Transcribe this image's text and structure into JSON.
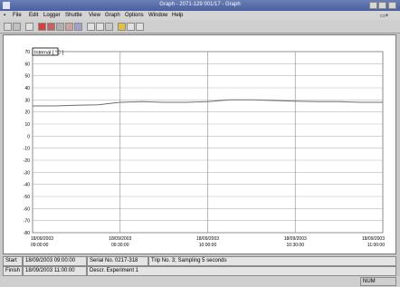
{
  "window": {
    "title": "Graph - 2071-129 001/17 - Graph"
  },
  "menu": [
    "File",
    "Edit",
    "Logger",
    "Shuttle",
    "View",
    "Graph",
    "Options",
    "Window",
    "Help"
  ],
  "chart": {
    "channel_label": "Internal [ °C ]"
  },
  "chart_data": {
    "type": "line",
    "ylim": [
      -80,
      70
    ],
    "y_ticks": [
      "70",
      "60",
      "50",
      "40",
      "30",
      "20",
      "10",
      "0",
      "-10",
      "-20",
      "-30",
      "-40",
      "-50",
      "-60",
      "-70",
      "-80"
    ],
    "x_ticks": [
      {
        "date": "18/09/2003",
        "time": "09:00:00"
      },
      {
        "date": "18/09/2003",
        "time": "09:30:00"
      },
      {
        "date": "18/09/2003",
        "time": "10:00:00"
      },
      {
        "date": "18/09/2003",
        "time": "10:30:00"
      },
      {
        "date": "18/09/2003",
        "time": "11:00:00"
      }
    ],
    "series": [
      {
        "color": "#6e6e6e",
        "x": [
          "09:00:00",
          "09:07:30",
          "09:15:00",
          "09:22:30",
          "09:30:00",
          "09:37:30",
          "09:45:00",
          "09:52:30",
          "10:00:00",
          "10:07:30",
          "10:15:00",
          "10:22:30",
          "10:30:00",
          "10:37:30",
          "10:45:00",
          "10:52:30",
          "11:00:00"
        ],
        "y": [
          25,
          25,
          25.5,
          26,
          28,
          28.5,
          28,
          28,
          28.5,
          30,
          30,
          29.5,
          29,
          28.5,
          28.5,
          28,
          28
        ]
      }
    ],
    "grid": true
  },
  "status": {
    "row1": {
      "start_label": "Start",
      "start_value": "18/09/2003 09:00:00",
      "serial": "Serial No. 0217-318",
      "trip": "Trip No. 3; Sampling 5 seconds"
    },
    "row2": {
      "finish_label": "Finish",
      "finish_value": "18/09/2003 11:00:00",
      "desc": "Descr. Experiment 1"
    }
  },
  "bottom": {
    "indicator": "NUM"
  }
}
